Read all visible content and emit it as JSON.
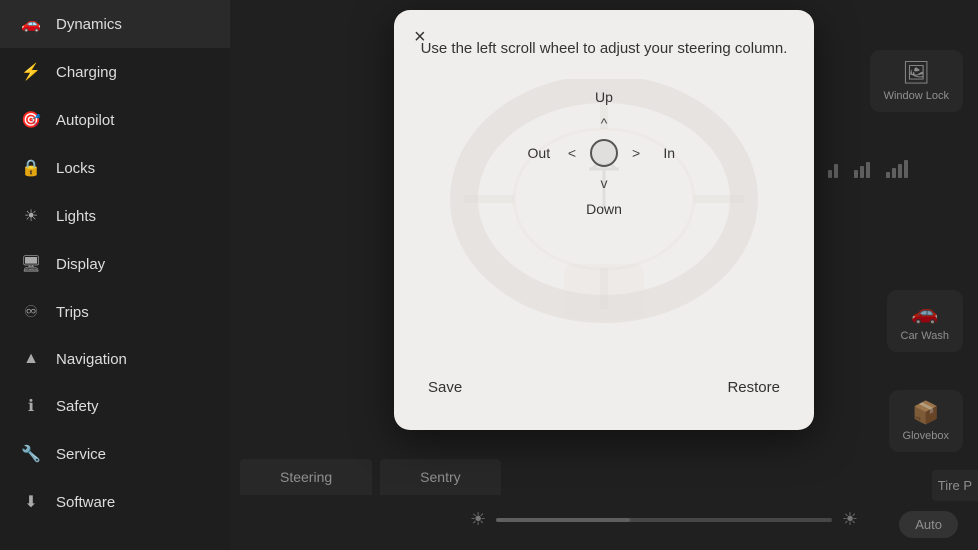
{
  "sidebar": {
    "items": [
      {
        "id": "dynamics",
        "label": "Dynamics",
        "icon": "🚗"
      },
      {
        "id": "charging",
        "label": "Charging",
        "icon": "⚡"
      },
      {
        "id": "autopilot",
        "label": "Autopilot",
        "icon": "🎯"
      },
      {
        "id": "locks",
        "label": "Locks",
        "icon": "🔒"
      },
      {
        "id": "lights",
        "label": "Lights",
        "icon": "☀"
      },
      {
        "id": "display",
        "label": "Display",
        "icon": "🖥"
      },
      {
        "id": "trips",
        "label": "Trips",
        "icon": "♾"
      },
      {
        "id": "navigation",
        "label": "Navigation",
        "icon": "▲"
      },
      {
        "id": "safety",
        "label": "Safety",
        "icon": "ℹ"
      },
      {
        "id": "service",
        "label": "Service",
        "icon": "🔧"
      },
      {
        "id": "software",
        "label": "Software",
        "icon": "⬇"
      }
    ]
  },
  "modal": {
    "close_label": "×",
    "title": "Use the left scroll wheel to adjust your steering column.",
    "direction_up": "Up",
    "direction_down": "Down",
    "direction_out": "Out",
    "direction_in": "In",
    "arrow_up": "^",
    "arrow_down": "v",
    "arrow_left": "<",
    "arrow_right": ">",
    "save_label": "Save",
    "restore_label": "Restore"
  },
  "right_panel": {
    "window_lock": {
      "icon": "🖼",
      "label": "Window Lock"
    },
    "car_wash": {
      "icon": "🚗",
      "label": "Car Wash"
    },
    "glovebox": {
      "icon": "📦",
      "label": "Glovebox"
    }
  },
  "bottom_tabs": [
    {
      "id": "steering",
      "label": "Steering"
    },
    {
      "id": "sentry",
      "label": "Sentry"
    }
  ],
  "auto_badge": "Auto",
  "tire_label": "Tire P"
}
